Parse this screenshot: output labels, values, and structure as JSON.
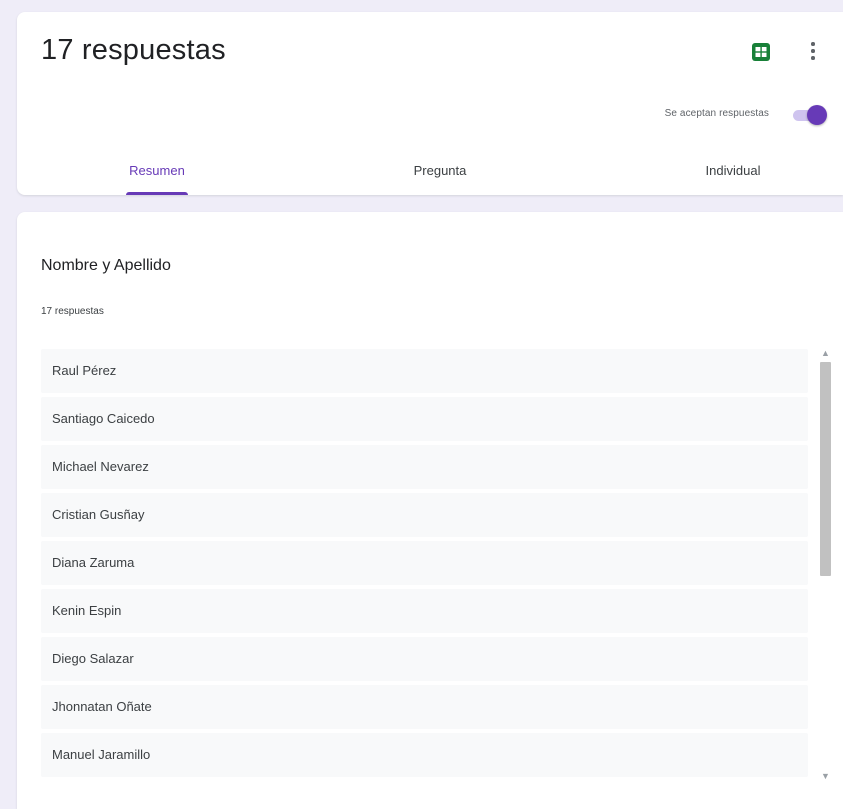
{
  "header": {
    "title": "17 respuestas",
    "accepting_label": "Se aceptan respuestas",
    "accepting_responses": true,
    "accent_color": "#673ab7",
    "sheets_icon": "sheets-icon",
    "menu_icon": "more-vert-icon"
  },
  "tabs": [
    {
      "label": "Resumen",
      "active": true
    },
    {
      "label": "Pregunta",
      "active": false
    },
    {
      "label": "Individual",
      "active": false
    }
  ],
  "question": {
    "title": "Nombre y Apellido",
    "response_count": "17 respuestas",
    "answers": [
      "Raul Pérez",
      "Santiago Caicedo",
      "Michael Nevarez",
      "Cristian Gusñay",
      "Diana Zaruma",
      "Kenin Espin",
      "Diego Salazar",
      "Jhonnatan Oñate",
      "Manuel Jaramillo"
    ]
  }
}
